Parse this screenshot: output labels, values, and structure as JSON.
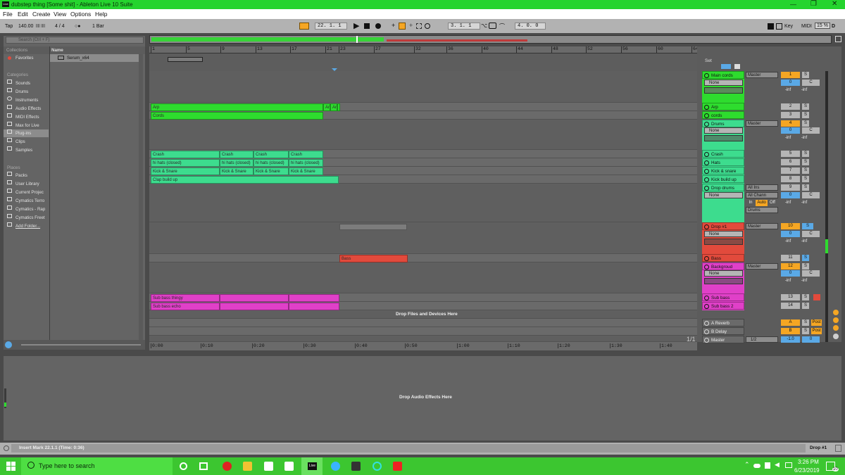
{
  "window": {
    "title": "dubstep thing  [Some shit]  - Ableton Live 10 Suite",
    "app_icon": "Live"
  },
  "menu": [
    "File",
    "Edit",
    "Create",
    "View",
    "Options",
    "Help"
  ],
  "transport": {
    "tap": "Tap",
    "tempo": "140.00",
    "nudge": "|||| ||||",
    "sig": "4 / 4",
    "metro": "○●",
    "quant": "1 Bar",
    "position": "22.  1.  1",
    "loop_start": "3.  1.  1",
    "loop_len": "4.  0.  0",
    "key": "Key",
    "midi": "MIDI",
    "cpu": "15 %",
    "d": "D"
  },
  "browser": {
    "search_placeholder": "Search (Ctrl + F)",
    "collections_label": "Collections",
    "favorites": "Favorites",
    "name_header": "Name",
    "file": "Serum_x64",
    "categories_label": "Categories",
    "categories": [
      "Sounds",
      "Drums",
      "Instruments",
      "Audio Effects",
      "MIDI Effects",
      "Max for Live",
      "Plug-ins",
      "Clips",
      "Samples"
    ],
    "places_label": "Places",
    "places": [
      "Packs",
      "User Library",
      "Current Projec",
      "Cymatics Terro",
      "Cymatics - Rap",
      "Cymatics Freet",
      "Add Folder..."
    ]
  },
  "ruler": [
    "1",
    "5",
    "9",
    "13",
    "17",
    "21",
    "23",
    "27",
    "32",
    "36",
    "40",
    "44",
    "48",
    "52",
    "56",
    "60",
    "64"
  ],
  "timeline": [
    "0:00",
    "0:10",
    "0:20",
    "0:30",
    "0:40",
    "0:50",
    "1:00",
    "1:10",
    "1:20",
    "1:30",
    "1:40"
  ],
  "clips": {
    "arp": "Arp",
    "arp_small": "Ar",
    "cords": "Cords",
    "crash": "Crash",
    "hats": "hi hats (closed)",
    "kick": "Kick & Snare",
    "clap": "Clap build up",
    "bass": "Bass",
    "sub1": "Sub bass thingy",
    "sub2": "Sub bass echo"
  },
  "drop_files": "Drop Files and Devices Here",
  "drop_audio": "Drop Audio Effects Here",
  "set_label": "Set",
  "tracks": [
    {
      "name": "Main cords",
      "num": "1",
      "out": "Master",
      "in": "None"
    },
    {
      "name": "Arp",
      "num": "2"
    },
    {
      "name": "cords",
      "num": "3"
    },
    {
      "name": "Drums",
      "num": "4",
      "out": "Master",
      "in": "None"
    },
    {
      "name": "Crash",
      "num": "5"
    },
    {
      "name": "Hats",
      "num": "6"
    },
    {
      "name": "Kick & snare",
      "num": "7"
    },
    {
      "name": "Kick build up",
      "num": "8"
    },
    {
      "name": "Drop drums",
      "num": "9",
      "in": "None",
      "input": "All Ins",
      "channel": "All Chann",
      "monitor_in": "In",
      "monitor_auto": "Auto",
      "monitor_off": "Off",
      "sub": "Drums"
    },
    {
      "name": "Drop #1",
      "num": "10",
      "out": "Master",
      "in": "None"
    },
    {
      "name": "Bass",
      "num": "11"
    },
    {
      "name": "Backgroud",
      "num": "12",
      "out": "Master",
      "in": "None"
    },
    {
      "name": "Sub bass",
      "num": "13"
    },
    {
      "name": "Sub bass 2",
      "num": "14"
    },
    {
      "name": "A Reverb",
      "num": "A"
    },
    {
      "name": "B Delay",
      "num": "B"
    },
    {
      "name": "Master",
      "num": "1/2"
    }
  ],
  "mixer": {
    "zero": "0",
    "inf": "-inf",
    "s": "S",
    "c": "C",
    "post": "Post",
    "master_vol": "-1.0",
    "master_pan": "0",
    "page": "1/1"
  },
  "status": {
    "text": "Insert Mark 22.1.1 (Time: 0:36)",
    "track": "Drop #1"
  },
  "taskbar": {
    "search": "Type here to search",
    "time": "3:26 PM",
    "date": "6/23/2019",
    "notif": "10",
    "live": "Live"
  },
  "colors": {
    "green": "#2edc2e",
    "teal": "#3ddc8e",
    "red": "#e24a3c",
    "pink": "#e040c8",
    "orange": "#f5a623",
    "blue": "#5aa9e6"
  }
}
